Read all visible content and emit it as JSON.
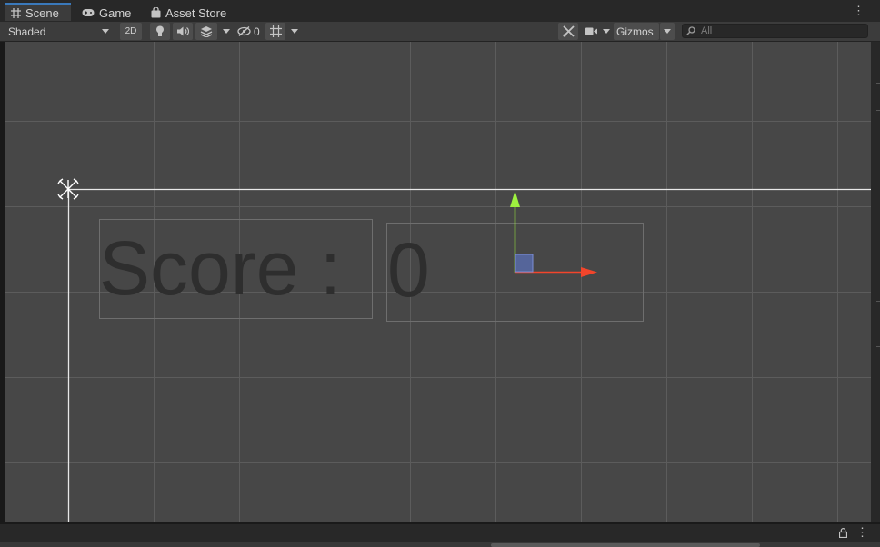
{
  "tabs": [
    {
      "label": "Scene",
      "icon": "grid-icon",
      "active": true
    },
    {
      "label": "Game",
      "icon": "gamepad-icon",
      "active": false
    },
    {
      "label": "Asset Store",
      "icon": "shopping-bag-icon",
      "active": false
    }
  ],
  "toolbar": {
    "shading_mode": "Shaded",
    "two_d_label": "2D",
    "hidden_count": "0",
    "gizmos_label": "Gizmos",
    "search_placeholder": "All"
  },
  "scene": {
    "score_label": "Score :",
    "score_value": "0"
  },
  "colors": {
    "accent": "#3a79bb",
    "gizmo_y": "#9ef13f",
    "gizmo_x": "#f2452b",
    "gizmo_handle": "#5a6fb6",
    "viewport_bg": "#474747",
    "grid_line": "#5c5c5c"
  }
}
